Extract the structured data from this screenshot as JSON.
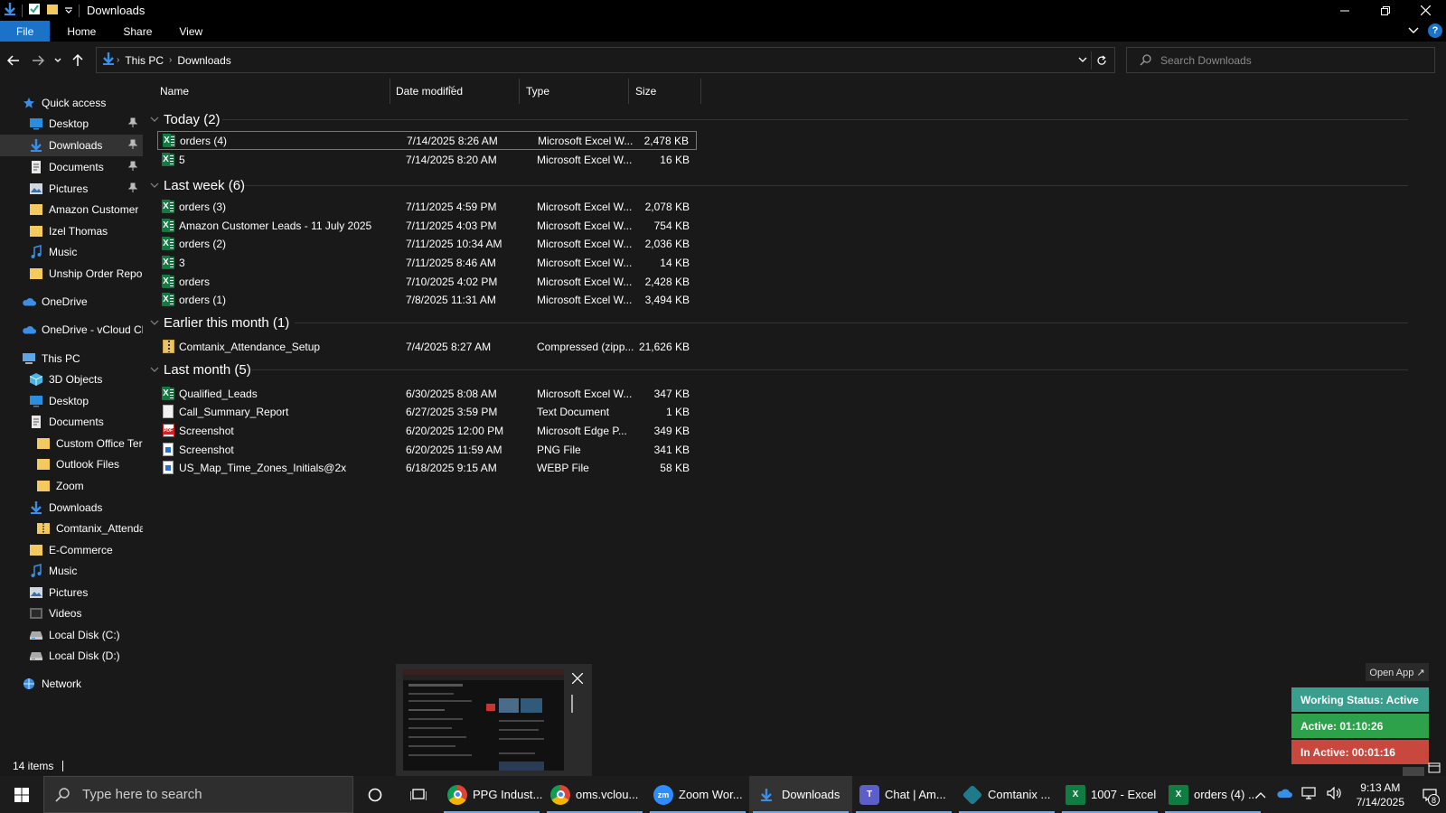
{
  "window": {
    "title": "Downloads",
    "colors": {
      "accent": "#1a73c9",
      "background": "#191919",
      "chrome": "#000000"
    }
  },
  "ribbon": {
    "tabs": [
      {
        "label": "File",
        "active": true
      },
      {
        "label": "Home"
      },
      {
        "label": "Share"
      },
      {
        "label": "View"
      }
    ],
    "help": "?"
  },
  "address": {
    "crumbs": [
      "This PC",
      "Downloads"
    ],
    "search_placeholder": "Search Downloads"
  },
  "nav_pane": {
    "items": [
      {
        "label": "Quick access",
        "icon": "star-icon",
        "level": 0
      },
      {
        "label": "Desktop",
        "icon": "desktop-icon",
        "level": 1,
        "pinned": true
      },
      {
        "label": "Downloads",
        "icon": "download-icon",
        "level": 1,
        "pinned": true,
        "selected": true
      },
      {
        "label": "Documents",
        "icon": "documents-icon",
        "level": 1,
        "pinned": true
      },
      {
        "label": "Pictures",
        "icon": "pictures-icon",
        "level": 1,
        "pinned": true
      },
      {
        "label": "Amazon Customer",
        "icon": "folder-icon",
        "level": 1
      },
      {
        "label": "Izel Thomas",
        "icon": "folder-icon",
        "level": 1
      },
      {
        "label": "Music",
        "icon": "music-icon",
        "level": 1
      },
      {
        "label": "Unship Order Repor",
        "icon": "folder-icon",
        "level": 1
      },
      {
        "label": "OneDrive",
        "icon": "cloud-icon",
        "level": 0
      },
      {
        "label": "OneDrive - vCloud Cl",
        "icon": "cloud-icon",
        "level": 0
      },
      {
        "label": "This PC",
        "icon": "computer-icon",
        "level": 0
      },
      {
        "label": "3D Objects",
        "icon": "cube-icon",
        "level": 1
      },
      {
        "label": "Desktop",
        "icon": "desktop-icon",
        "level": 1
      },
      {
        "label": "Documents",
        "icon": "documents-icon",
        "level": 1
      },
      {
        "label": "Custom Office Ter",
        "icon": "folder-icon",
        "level": 2
      },
      {
        "label": "Outlook Files",
        "icon": "folder-icon",
        "level": 2
      },
      {
        "label": "Zoom",
        "icon": "folder-icon",
        "level": 2
      },
      {
        "label": "Downloads",
        "icon": "download-icon",
        "level": 1
      },
      {
        "label": "Comtanix_Attenda",
        "icon": "zip-folder-icon",
        "level": 2
      },
      {
        "label": "E-Commerce",
        "icon": "folder-icon",
        "level": 1
      },
      {
        "label": "Music",
        "icon": "music-icon",
        "level": 1
      },
      {
        "label": "Pictures",
        "icon": "pictures-icon",
        "level": 1
      },
      {
        "label": "Videos",
        "icon": "videos-icon",
        "level": 1
      },
      {
        "label": "Local Disk (C:)",
        "icon": "drive-icon",
        "level": 1
      },
      {
        "label": "Local Disk (D:)",
        "icon": "drive-icon",
        "level": 1
      },
      {
        "label": "Network",
        "icon": "network-icon",
        "level": 0
      }
    ]
  },
  "columns": [
    "Name",
    "Date modified",
    "Type",
    "Size"
  ],
  "groups": [
    {
      "label": "Today (2)",
      "files": [
        {
          "name": "orders (4)",
          "date": "7/14/2025 8:26 AM",
          "type": "Microsoft Excel W...",
          "size": "2,478 KB",
          "icon": "excel-icon",
          "selected": true
        },
        {
          "name": "5",
          "date": "7/14/2025 8:20 AM",
          "type": "Microsoft Excel W...",
          "size": "16 KB",
          "icon": "excel-icon"
        }
      ]
    },
    {
      "label": "Last week (6)",
      "files": [
        {
          "name": "orders (3)",
          "date": "7/11/2025 4:59 PM",
          "type": "Microsoft Excel W...",
          "size": "2,078 KB",
          "icon": "excel-icon"
        },
        {
          "name": "Amazon Customer Leads - 11 July 2025",
          "date": "7/11/2025 4:03 PM",
          "type": "Microsoft Excel W...",
          "size": "754 KB",
          "icon": "excel-icon"
        },
        {
          "name": "orders (2)",
          "date": "7/11/2025 10:34 AM",
          "type": "Microsoft Excel W...",
          "size": "2,036 KB",
          "icon": "excel-icon"
        },
        {
          "name": "3",
          "date": "7/11/2025 8:46 AM",
          "type": "Microsoft Excel W...",
          "size": "14 KB",
          "icon": "excel-icon"
        },
        {
          "name": "orders",
          "date": "7/10/2025 4:02 PM",
          "type": "Microsoft Excel W...",
          "size": "2,428 KB",
          "icon": "excel-icon"
        },
        {
          "name": "orders (1)",
          "date": "7/8/2025 11:31 AM",
          "type": "Microsoft Excel W...",
          "size": "3,494 KB",
          "icon": "excel-icon"
        }
      ]
    },
    {
      "label": "Earlier this month (1)",
      "files": [
        {
          "name": "Comtanix_Attendance_Setup",
          "date": "7/4/2025 8:27 AM",
          "type": "Compressed (zipp...",
          "size": "21,626 KB",
          "icon": "zip-icon"
        }
      ]
    },
    {
      "label": "Last month (5)",
      "files": [
        {
          "name": "Qualified_Leads",
          "date": "6/30/2025 8:08 AM",
          "type": "Microsoft Excel W...",
          "size": "347 KB",
          "icon": "excel-icon"
        },
        {
          "name": "Call_Summary_Report",
          "date": "6/27/2025 3:59 PM",
          "type": "Text Document",
          "size": "1 KB",
          "icon": "text-file-icon"
        },
        {
          "name": "Screenshot",
          "date": "6/20/2025 12:00 PM",
          "type": "Microsoft Edge P...",
          "size": "349 KB",
          "icon": "pdf-icon"
        },
        {
          "name": "Screenshot",
          "date": "6/20/2025 11:59 AM",
          "type": "PNG File",
          "size": "341 KB",
          "icon": "png-icon"
        },
        {
          "name": "US_Map_Time_Zones_Initials@2x",
          "date": "6/18/2025 9:15 AM",
          "type": "WEBP File",
          "size": "58 KB",
          "icon": "webp-icon"
        }
      ]
    }
  ],
  "status": {
    "item_count": "14 items"
  },
  "widget": {
    "open_app": "Open App ↗",
    "working_status": "Working Status: Active",
    "active_time": "Active: 01:10:26",
    "inactive_time": "In Active: 00:01:16",
    "colors": {
      "working": "#3a9e8f",
      "active": "#2ea24a",
      "inactive": "#c9473c"
    }
  },
  "taskbar": {
    "search_placeholder": "Type here to search",
    "apps": [
      {
        "label": "PPG Indust...",
        "icon": "chrome-icon"
      },
      {
        "label": "oms.vclou...",
        "icon": "chrome-icon"
      },
      {
        "label": "Zoom Wor...",
        "icon": "zoom-icon"
      },
      {
        "label": "Downloads",
        "icon": "explorer-icon",
        "active": true
      },
      {
        "label": "Chat | Am...",
        "icon": "teams-icon"
      },
      {
        "label": "Comtanix ...",
        "icon": "comtanix-icon"
      },
      {
        "label": "1007 - Excel",
        "icon": "excel-icon"
      },
      {
        "label": "orders (4) ...",
        "icon": "excel-icon"
      }
    ],
    "clock": {
      "time": "9:13 AM",
      "date": "7/14/2025"
    },
    "notification_count": "8"
  }
}
